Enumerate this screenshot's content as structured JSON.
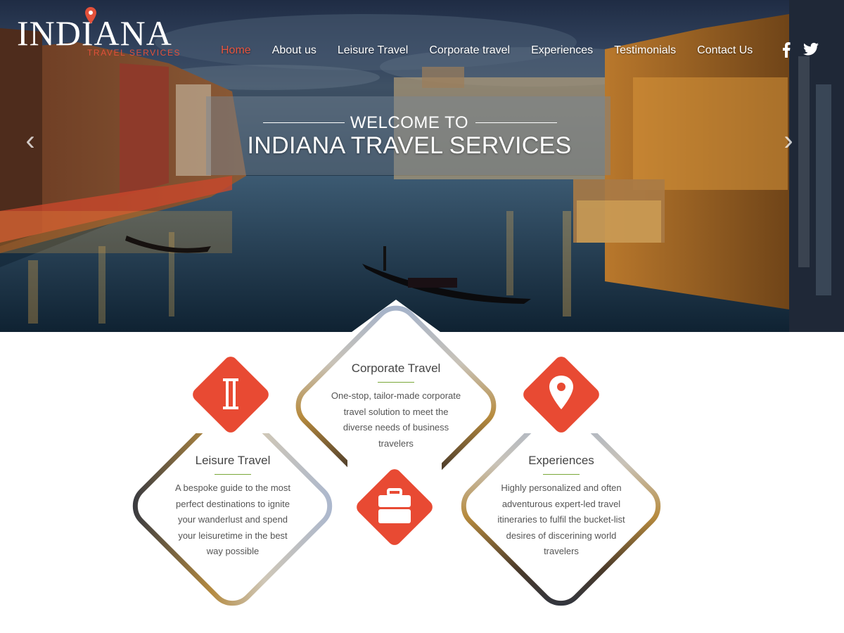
{
  "header": {
    "logo_title": "INDIANA",
    "logo_subtitle": "TRAVEL SERVICES",
    "nav": [
      {
        "label": "Home",
        "active": true
      },
      {
        "label": "About us",
        "active": false
      },
      {
        "label": "Leisure Travel",
        "active": false
      },
      {
        "label": "Corporate travel",
        "active": false
      },
      {
        "label": "Experiences",
        "active": false
      },
      {
        "label": "Testimonials",
        "active": false
      },
      {
        "label": "Contact Us",
        "active": false
      }
    ],
    "social": [
      "facebook-icon",
      "twitter-icon"
    ]
  },
  "hero": {
    "welcome": "WELCOME TO",
    "headline": "INDIANA TRAVEL SERVICES",
    "prev_icon": "chevron-left-icon",
    "next_icon": "chevron-right-icon"
  },
  "cards": {
    "leisure": {
      "title": "Leisure Travel",
      "desc": "A bespoke guide to the most perfect destinations to ignite your wanderlust and spend your leisuretime in the best way possible",
      "icon": "column-icon"
    },
    "corporate": {
      "title": "Corporate Travel",
      "desc": "One-stop, tailor-made corporate travel solution to meet the diverse needs of business travelers",
      "icon": "briefcase-icon"
    },
    "experiences": {
      "title": "Experiences",
      "desc": "Highly personalized and often adventurous expert-led travel itineraries to fulfil the bucket-list desires of discerining world travelers",
      "icon": "location-pin-icon"
    }
  },
  "colors": {
    "accent": "#e84a33",
    "nav_active": "#e8553f",
    "rule_green": "#7aa83a"
  }
}
